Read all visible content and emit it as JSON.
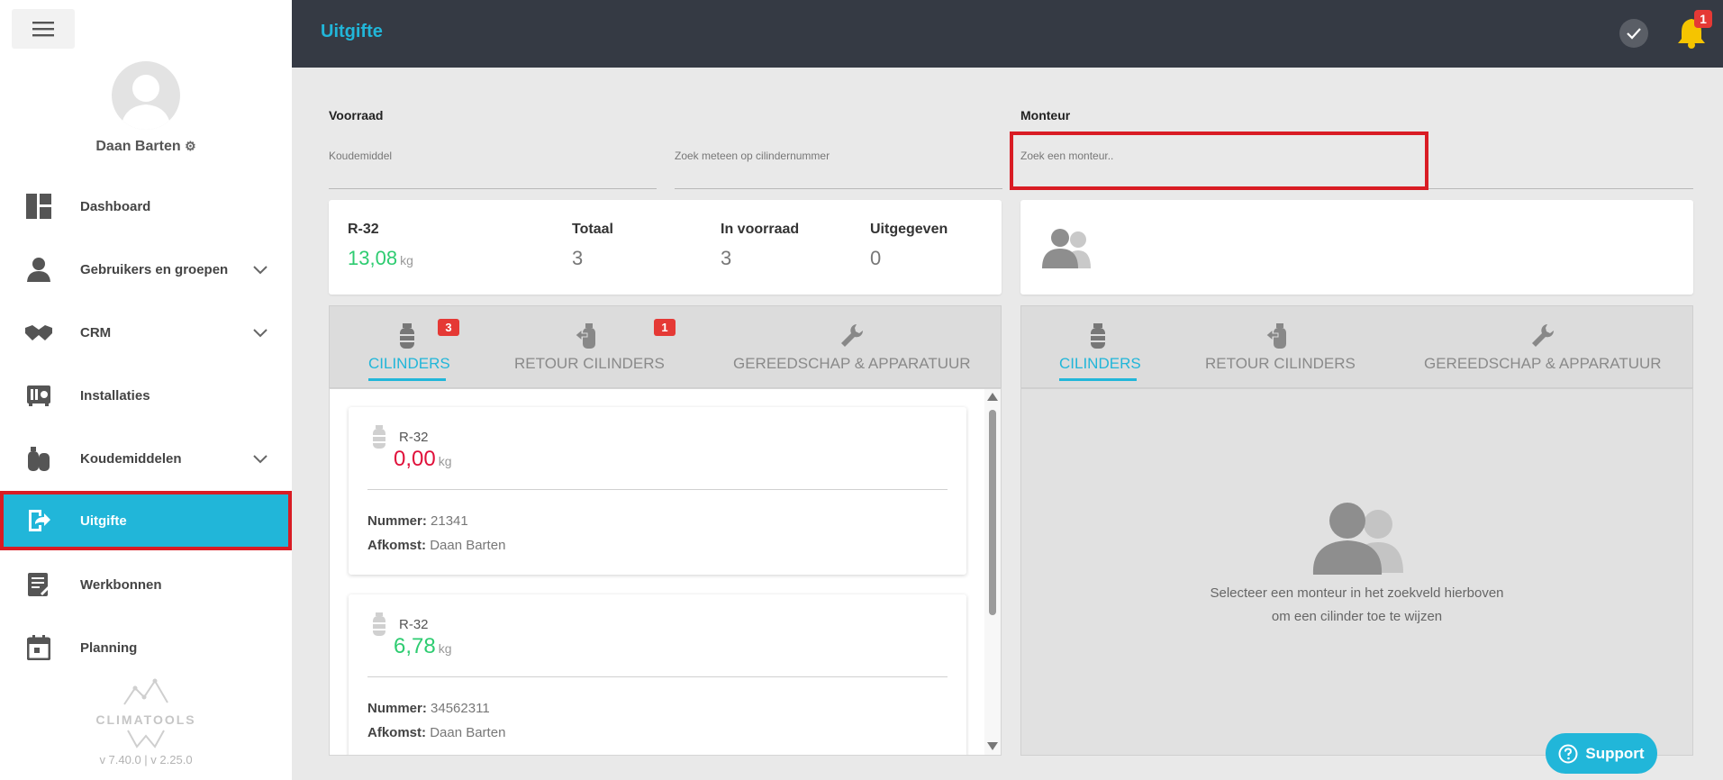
{
  "sidebar": {
    "user_name": "Daan Barten",
    "items": [
      {
        "label": "Dashboard",
        "icon": "dashboard-icon"
      },
      {
        "label": "Gebruikers en groepen",
        "icon": "person-icon"
      },
      {
        "label": "CRM",
        "icon": "handshake-icon"
      },
      {
        "label": "Installaties",
        "icon": "airco-unit-icon"
      },
      {
        "label": "Koudemiddelen",
        "icon": "cylinders-icon"
      },
      {
        "label": "Uitgifte",
        "icon": "export-icon"
      },
      {
        "label": "Werkbonnen",
        "icon": "workorder-icon"
      },
      {
        "label": "Planning",
        "icon": "calendar-icon"
      }
    ],
    "brand": "CLIMATOOLS",
    "version": "v 7.40.0  | v 2.25.0"
  },
  "topbar": {
    "title": "Uitgifte",
    "notification_count": "1"
  },
  "filters": {
    "voorraad_label": "Voorraad",
    "monteur_label": "Monteur",
    "koudemiddel_placeholder": "Koudemiddel",
    "cilinder_placeholder": "Zoek meteen op cilindernummer",
    "monteur_placeholder": "Zoek een monteur.."
  },
  "summary": {
    "refrigerant": "R-32",
    "weight": "13,08",
    "weight_unit": "kg",
    "totaal_label": "Totaal",
    "totaal": "3",
    "in_voorraad_label": "In voorraad",
    "in_voorraad": "3",
    "uitgegeven_label": "Uitgegeven",
    "uitgegeven": "0"
  },
  "left_tabs": [
    {
      "label": "CILINDERS",
      "badge": "3"
    },
    {
      "label": "RETOUR CILINDERS",
      "badge": "1"
    },
    {
      "label": "GEREEDSCHAP & APPARATUUR"
    }
  ],
  "right_tabs": [
    {
      "label": "CILINDERS"
    },
    {
      "label": "RETOUR CILINDERS"
    },
    {
      "label": "GEREEDSCHAP & APPARATUUR"
    }
  ],
  "cylinders": [
    {
      "name": "R-32",
      "weight": "0,00",
      "unit": "kg",
      "nummer_label": "Nummer:",
      "nummer": "21341",
      "afkomst_label": "Afkomst:",
      "afkomst": "Daan Barten"
    },
    {
      "name": "R-32",
      "weight": "6,78",
      "unit": "kg",
      "nummer_label": "Nummer:",
      "nummer": "34562311",
      "afkomst_label": "Afkomst:",
      "afkomst": "Daan Barten"
    }
  ],
  "empty_state": {
    "line1": "Selecteer een monteur in het zoekveld hierboven",
    "line2": "om een cilinder toe te wijzen"
  },
  "support_label": "Support",
  "colors": {
    "accent": "#21b6d9",
    "topbar": "#353a44",
    "highlight": "#d91c24",
    "positive": "#2ecc71",
    "negative": "#e0103a"
  }
}
